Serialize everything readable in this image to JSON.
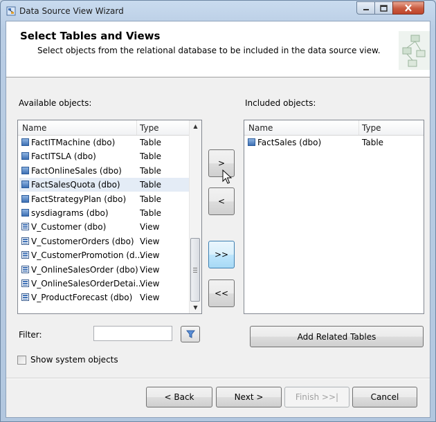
{
  "window": {
    "title": "Data Source View Wizard",
    "controls": {
      "minimize_icon": "minimize-icon",
      "maximize_icon": "maximize-icon",
      "close_icon": "close-icon"
    }
  },
  "header": {
    "title": "Select Tables and Views",
    "subtitle": "Select objects from the relational database to be included in the data source view."
  },
  "available": {
    "label": "Available objects:",
    "columns": {
      "name": "Name",
      "type": "Type"
    },
    "rows": [
      {
        "name": "FactITMachine (dbo)",
        "type": "Table",
        "icon": "table-icon"
      },
      {
        "name": "FactITSLA (dbo)",
        "type": "Table",
        "icon": "table-icon"
      },
      {
        "name": "FactOnlineSales (dbo)",
        "type": "Table",
        "icon": "table-icon"
      },
      {
        "name": "FactSalesQuota (dbo)",
        "type": "Table",
        "icon": "table-icon",
        "selected": true
      },
      {
        "name": "FactStrategyPlan (dbo)",
        "type": "Table",
        "icon": "table-icon"
      },
      {
        "name": "sysdiagrams (dbo)",
        "type": "Table",
        "icon": "table-icon"
      },
      {
        "name": "V_Customer (dbo)",
        "type": "View",
        "icon": "view-icon"
      },
      {
        "name": "V_CustomerOrders (dbo)",
        "type": "View",
        "icon": "view-icon"
      },
      {
        "name": "V_CustomerPromotion (d...",
        "type": "View",
        "icon": "view-icon"
      },
      {
        "name": "V_OnlineSalesOrder (dbo)",
        "type": "View",
        "icon": "view-icon"
      },
      {
        "name": "V_OnlineSalesOrderDetai...",
        "type": "View",
        "icon": "view-icon"
      },
      {
        "name": "V_ProductForecast (dbo)",
        "type": "View",
        "icon": "view-icon"
      }
    ]
  },
  "transfer": {
    "add": ">",
    "remove": "<",
    "add_all": ">>",
    "remove_all": "<<"
  },
  "included": {
    "label": "Included objects:",
    "columns": {
      "name": "Name",
      "type": "Type"
    },
    "rows": [
      {
        "name": "FactSales (dbo)",
        "type": "Table",
        "icon": "table-icon"
      }
    ]
  },
  "filter": {
    "label": "Filter:",
    "value": "",
    "icon": "filter-funnel-icon"
  },
  "add_related": "Add Related Tables",
  "show_system": {
    "label": "Show system objects",
    "checked": false
  },
  "footer": {
    "back": "< Back",
    "next": "Next >",
    "finish": "Finish >>|",
    "cancel": "Cancel"
  },
  "colors": {
    "selection": "#e4ecf6",
    "focus_border": "#3c7fb1"
  }
}
